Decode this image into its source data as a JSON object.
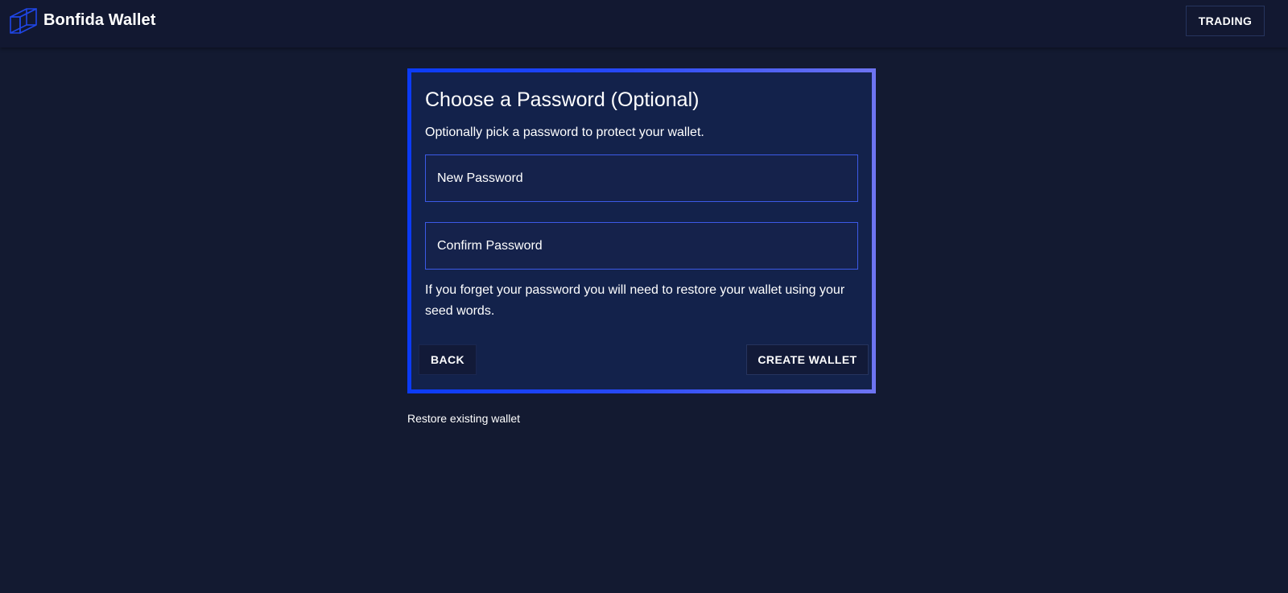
{
  "header": {
    "brand": "Bonfida Wallet",
    "logo_icon": "cube-icon",
    "trading_label": "TRADING"
  },
  "card": {
    "title": "Choose a Password (Optional)",
    "subtitle": "Optionally pick a password to protect your wallet.",
    "new_password": {
      "placeholder": "New Password",
      "value": ""
    },
    "confirm_password": {
      "placeholder": "Confirm Password",
      "value": ""
    },
    "warning": "If you forget your password you will need to restore your wallet using your seed words.",
    "back_label": "BACK",
    "create_label": "CREATE WALLET"
  },
  "restore_link": "Restore existing wallet",
  "colors": {
    "background": "#131a31",
    "card": "#13224b",
    "gradient_start": "#0b3bf5",
    "gradient_end": "#6e74f1",
    "field_border": "#3c5ae6"
  }
}
